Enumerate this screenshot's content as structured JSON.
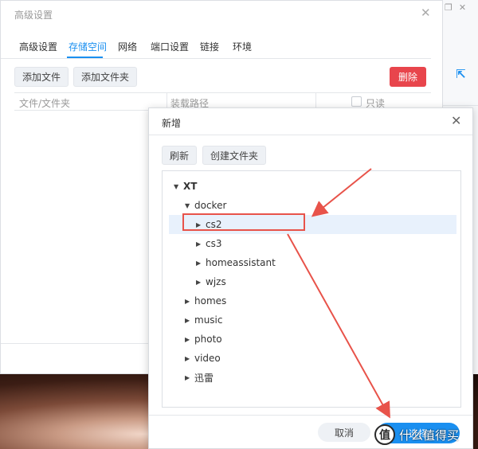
{
  "settings": {
    "title": "高级设置",
    "tabs": [
      {
        "label": "高级设置"
      },
      {
        "label": "存储空间",
        "active": true
      },
      {
        "label": "网络"
      },
      {
        "label": "端口设置"
      },
      {
        "label": "链接"
      },
      {
        "label": "环境"
      }
    ],
    "add_file_label": "添加文件",
    "add_folder_label": "添加文件夹",
    "delete_label": "删除",
    "columns": {
      "file": "文件/文件夹",
      "mount": "装载路径",
      "readonly": "只读"
    }
  },
  "dialog": {
    "title": "新增",
    "refresh_label": "刷新",
    "create_folder_label": "创建文件夹",
    "tree": {
      "root": "XT",
      "docker": "docker",
      "docker_children": [
        "cs2",
        "cs3",
        "homeassistant",
        "wjzs"
      ],
      "others": [
        "homes",
        "music",
        "photo",
        "video",
        "迅雷"
      ]
    },
    "selected": "cs2",
    "cancel_label": "取消",
    "confirm_label": "选择"
  },
  "watermark": {
    "logo": "值",
    "text": "什么值得买"
  },
  "colors": {
    "accent": "#1a8ff0",
    "danger": "#e8454c",
    "annotation": "#e8534a",
    "selection": "#e8f1fc"
  }
}
